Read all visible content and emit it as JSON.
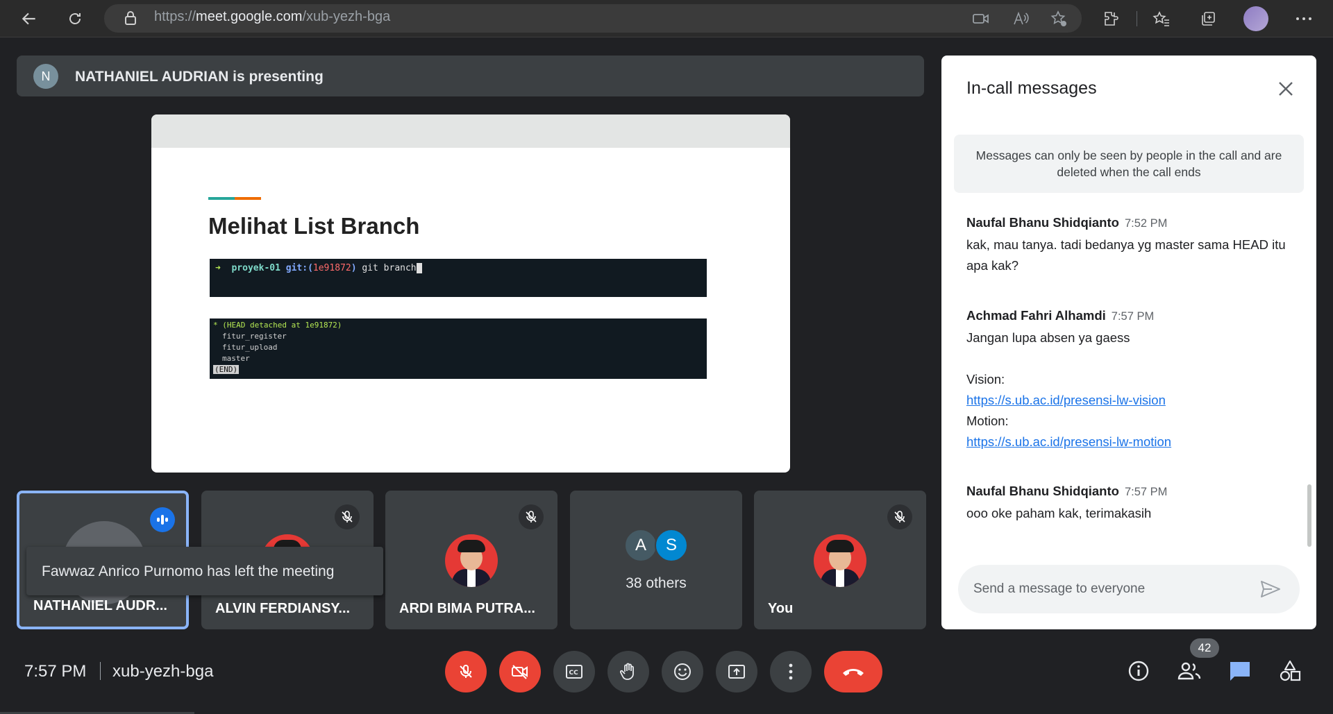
{
  "browser": {
    "url_scheme": "https://",
    "url_host": "meet.google.com",
    "url_path": "/xub-yezh-bga"
  },
  "presenting": {
    "avatar_letter": "N",
    "text": "NATHANIEL AUDRIAN is presenting"
  },
  "slide": {
    "title": "Melihat List Branch",
    "term1": {
      "arrow": "➜",
      "dir": "proyek-01",
      "git_label": "git:(",
      "hash": "1e91872",
      "git_close": ")",
      "command": "git branch"
    },
    "term2_lines": [
      "* (HEAD detached at 1e91872)",
      "fitur_register",
      "fitur_upload",
      "master"
    ],
    "term2_end": "(END)"
  },
  "tiles": [
    {
      "name": "NATHANIEL AUDR..."
    },
    {
      "name": "ALVIN FERDIANSY..."
    },
    {
      "name": "ARDI BIMA PUTRA..."
    },
    {
      "others_letters": [
        "A",
        "S"
      ],
      "others_colors": [
        "#455a64",
        "#0288d1"
      ],
      "label": "38 others"
    },
    {
      "name": "You"
    }
  ],
  "toast": "Fawwaz Anrico Purnomo has left the meeting",
  "chat": {
    "title": "In-call messages",
    "info": "Messages can only be seen by people in the call and are deleted when the call ends",
    "messages": [
      {
        "sender": "Naufal Bhanu Shidqianto",
        "time": "7:52 PM",
        "text": "kak, mau tanya. tadi bedanya yg master sama HEAD itu apa kak?"
      },
      {
        "sender": "Achmad Fahri Alhamdi",
        "time": "7:57 PM",
        "text": "Jangan lupa absen ya gaess",
        "vision_label": "Vision:",
        "vision_link": "https://s.ub.ac.id/presensi-lw-vision",
        "motion_label": "Motion:",
        "motion_link": "https://s.ub.ac.id/presensi-lw-motion"
      },
      {
        "sender": "Naufal Bhanu Shidqianto",
        "time": "7:57 PM",
        "text": "ooo oke paham kak, terimakasih"
      }
    ],
    "input_placeholder": "Send a message to everyone"
  },
  "bottom": {
    "time": "7:57 PM",
    "meeting_code": "xub-yezh-bga",
    "participant_count": "42"
  },
  "colors": {
    "accent": "#8ab4f8",
    "danger": "#ea4335",
    "chat_active": "#8ab4f8"
  }
}
